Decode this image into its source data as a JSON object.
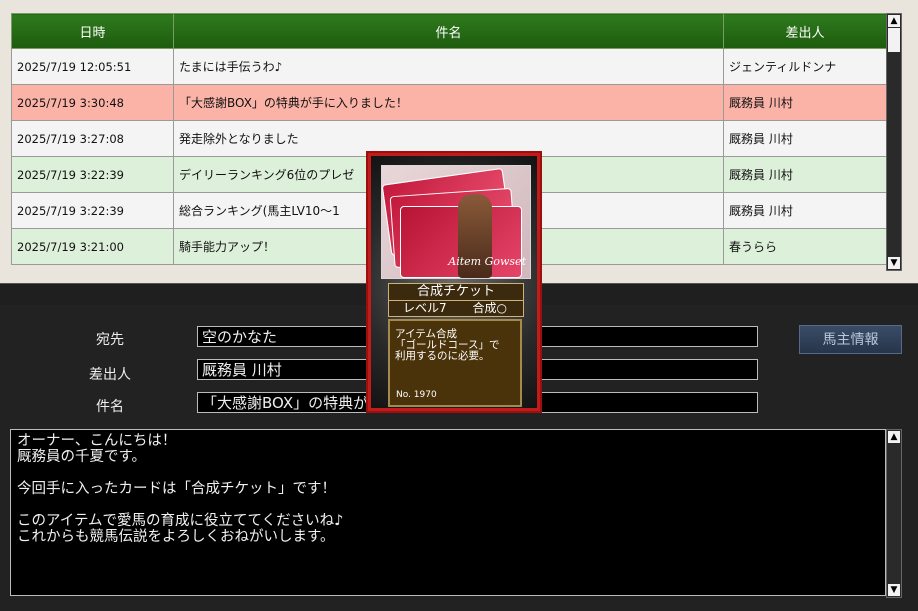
{
  "table": {
    "headers": {
      "date": "日時",
      "subject": "件名",
      "sender": "差出人"
    },
    "rows": [
      {
        "date": "2025/7/19 12:05:51",
        "subject": "たまには手伝うわ♪",
        "sender": "ジェンティルドンナ"
      },
      {
        "date": "2025/7/19 3:30:48",
        "subject": "「大感謝BOX」の特典が手に入りました！",
        "sender": "厩務員 川村"
      },
      {
        "date": "2025/7/19 3:27:08",
        "subject": "発走除外となりました",
        "sender": "厩務員 川村"
      },
      {
        "date": "2025/7/19 3:22:39",
        "subject": "デイリーランキング6位のプレゼ",
        "sender": "厩務員 川村"
      },
      {
        "date": "2025/7/19 3:22:39",
        "subject": "総合ランキング(馬主LV10～1",
        "sender": "厩務員 川村"
      },
      {
        "date": "2025/7/19 3:21:00",
        "subject": "騎手能力アップ！",
        "sender": "春うらら"
      }
    ]
  },
  "detail": {
    "to_label": "宛先",
    "to_value": "空のかなた",
    "from_label": "差出人",
    "from_value": "厩務員 川村",
    "subject_label": "件名",
    "subject_value": "「大感謝BOX」の特典が",
    "owner_info_button": "馬主情報",
    "body_lines": [
      "オーナー、こんにちは！",
      "厩務員の千夏です。",
      "",
      "今回手に入ったカードは「合成チケット」です！",
      "",
      "このアイテムで愛馬の育成に役立ててくださいね♪",
      "これからも競馬伝説をよろしくおねがいします。"
    ]
  },
  "card": {
    "name": "合成チケット",
    "level": "レベル7",
    "type": "合成○",
    "desc_lines": [
      "アイテム合成",
      "「ゴールドコース」で",
      "利用するのに必要。"
    ],
    "number": "No. 1970",
    "logo_text": "Aitem Gowset"
  },
  "colors": {
    "header_green": "#1d5b0e",
    "selected_row": "#fbb3a8",
    "green_row": "#ddf0da",
    "unread_text": "#1c3ccf"
  }
}
